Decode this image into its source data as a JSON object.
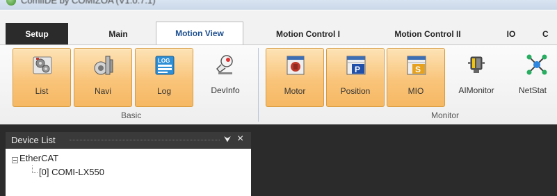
{
  "window": {
    "title": "ComiIDE by COMIZOA (V1.0.7.1)"
  },
  "tabs": [
    {
      "label": "Setup"
    },
    {
      "label": "Main"
    },
    {
      "label": "Motion View"
    },
    {
      "label": "Motion Control I"
    },
    {
      "label": "Motion Control II"
    },
    {
      "label": "IO"
    },
    {
      "label": "C"
    }
  ],
  "ribbon": {
    "basic": {
      "group_label": "Basic",
      "buttons": [
        {
          "label": "List",
          "icon": "gears-list-icon"
        },
        {
          "label": "Navi",
          "icon": "navigation-icon"
        },
        {
          "label": "Log",
          "icon": "log-icon"
        },
        {
          "label": "DevInfo",
          "icon": "device-info-icon"
        }
      ]
    },
    "monitor": {
      "group_label": "Monitor",
      "buttons": [
        {
          "label": "Motor",
          "icon": "motor-icon"
        },
        {
          "label": "Position",
          "icon": "position-icon"
        },
        {
          "label": "MIO",
          "icon": "mio-icon"
        },
        {
          "label": "AIMonitor",
          "icon": "ai-monitor-icon"
        },
        {
          "label": "NetStat",
          "icon": "network-status-icon"
        }
      ]
    }
  },
  "device_panel": {
    "title": "Device List",
    "pin_glyph": "⮟",
    "close_glyph": "×",
    "tree": [
      {
        "label": "EtherCAT",
        "children": [
          {
            "label": "[0] COMI-LX550"
          }
        ]
      }
    ]
  },
  "colors": {
    "dark_bg": "#2b2b2b",
    "ribbon_highlight": "#f9c47a",
    "active_tab_text": "#1d4f8f"
  }
}
